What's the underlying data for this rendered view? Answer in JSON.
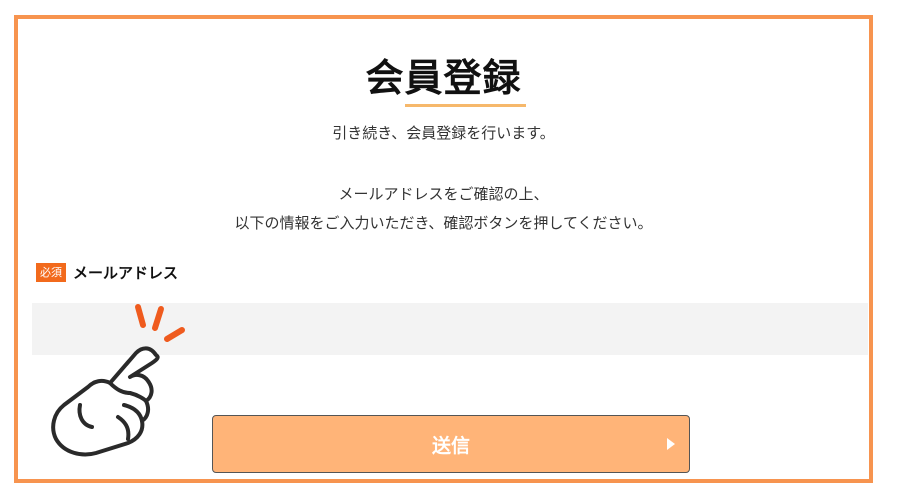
{
  "page": {
    "title": "会員登録",
    "intro": "引き続き、会員登録を行います。",
    "description_lines": [
      "メールアドレスをご確認の上、",
      "以下の情報をご入力いただき、確認ボタンを押してください。"
    ]
  },
  "form": {
    "email": {
      "required_badge": "必須",
      "label": "メールアドレス",
      "value": ""
    },
    "submit_label": "送信"
  },
  "colors": {
    "frame": "#f7944f",
    "accent": "#f26a1c",
    "button": "#ffb478",
    "underline": "#f6b86b"
  },
  "icons": {
    "pointing_hand": "pointing-hand-icon",
    "submit_arrow": "triangle-right-icon"
  }
}
